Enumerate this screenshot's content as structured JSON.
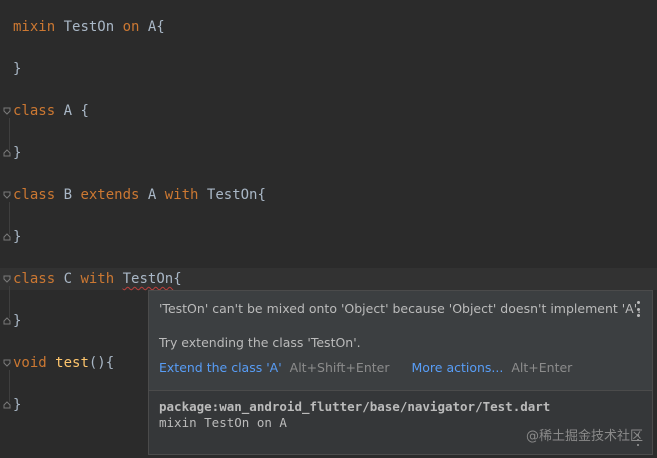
{
  "colors": {
    "background": "#2b2b2b",
    "keyword": "#cc7832",
    "function": "#ffc66d",
    "identifier": "#a9b7c6",
    "error_squiggle": "#bc3f3c",
    "link": "#589df6",
    "popup_background": "#3c3f41"
  },
  "editor": {
    "lines": [
      {
        "kw1": "mixin",
        "t1": " TestOn ",
        "kw2": "on",
        "t2": " A{"
      },
      {
        "text": "}"
      },
      {
        "kw1": "class",
        "t1": " A {"
      },
      {
        "text": "}"
      },
      {
        "kw1": "class",
        "t1": " B ",
        "kw2": "extends",
        "t2": " A ",
        "kw3": "with",
        "t3": " TestOn{"
      },
      {
        "text": "}"
      },
      {
        "kw1": "class",
        "t1": " C ",
        "kw2": "with",
        "t2": " ",
        "err": "TestOn",
        "t3": "{"
      },
      {
        "text": "}"
      },
      {
        "kw1": "void",
        "t1": " ",
        "fn": "test",
        "t2": "(){"
      },
      {
        "text": "}"
      }
    ]
  },
  "popup": {
    "error_message": "'TestOn' can't be mixed onto 'Object' because 'Object' doesn't implement 'A'.",
    "suggestion": "Try extending the class 'TestOn'.",
    "actions": [
      {
        "label": "Extend the class 'A'",
        "shortcut": "Alt+Shift+Enter"
      },
      {
        "label": "More actions...",
        "shortcut": "Alt+Enter"
      }
    ],
    "doc_path": "package:wan_android_flutter/base/navigator/Test.dart",
    "doc_declaration": "mixin TestOn on A",
    "menu_icon": "kebab-menu-icon"
  },
  "watermark": "@稀土掘金技术社区"
}
